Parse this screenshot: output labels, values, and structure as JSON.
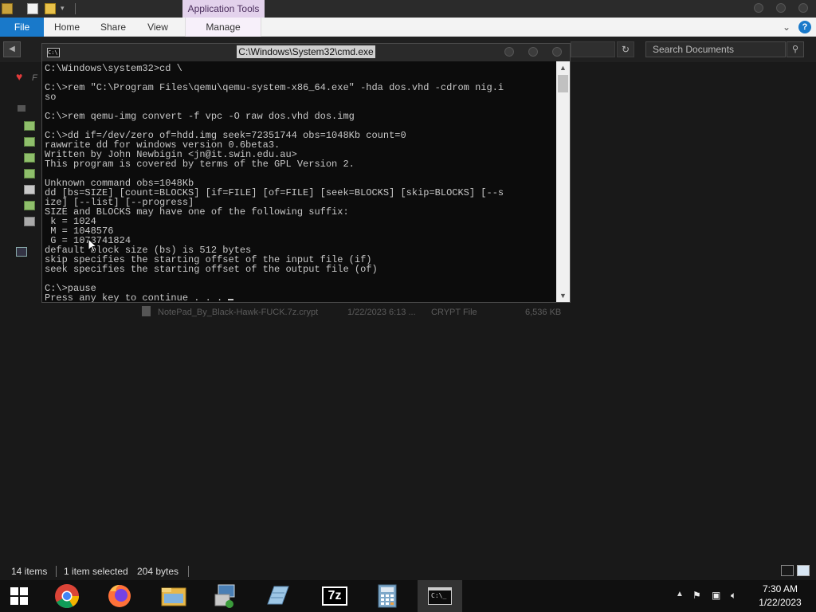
{
  "explorer": {
    "contextual_tab": "Application Tools",
    "tabs": {
      "file": "File",
      "home": "Home",
      "share": "Share",
      "view": "View",
      "manage": "Manage"
    },
    "search_placeholder": "Search Documents",
    "nav_fav_label": "F",
    "file_row": {
      "name": "NotePad_By_Black-Hawk-FUCK.7z.crypt",
      "date": "1/22/2023 6:13 ...",
      "type": "CRYPT File",
      "size": "6,536 KB"
    },
    "status": {
      "item_count": "14 items",
      "selected": "1 item selected",
      "size": "204 bytes"
    }
  },
  "cmd": {
    "title": "C:\\Windows\\System32\\cmd.exe",
    "icon_text": "C:\\",
    "lines": [
      "C:\\Windows\\system32>cd \\",
      "",
      "C:\\>rem \"C:\\Program Files\\qemu\\qemu-system-x86_64.exe\" -hda dos.vhd -cdrom nig.i",
      "so",
      "",
      "C:\\>rem qemu-img convert -f vpc -O raw dos.vhd dos.img",
      "",
      "C:\\>dd if=/dev/zero of=hdd.img seek=72351744 obs=1048Kb count=0",
      "rawwrite dd for windows version 0.6beta3.",
      "Written by John Newbigin <jn@it.swin.edu.au>",
      "This program is covered by terms of the GPL Version 2.",
      "",
      "Unknown command obs=1048Kb",
      "dd [bs=SIZE] [count=BLOCKS] [if=FILE] [of=FILE] [seek=BLOCKS] [skip=BLOCKS] [--s",
      "ize] [--list] [--progress]",
      "SIZE and BLOCKS may have one of the following suffix:",
      " k = 1024",
      " M = 1048576",
      " G = 1073741824",
      "default block size (bs) is 512 bytes",
      "skip specifies the starting offset of the input file (if)",
      "seek specifies the starting offset of the output file (of)",
      "",
      "C:\\>pause",
      "Press any key to continue . . . "
    ]
  },
  "taskbar": {
    "apps": [
      "chrome-icon",
      "firefox-icon",
      "file-explorer-icon",
      "remote-desktop-icon",
      "notepad-icon",
      "7zip-icon",
      "calculator-icon",
      "cmd-icon"
    ],
    "seven_zip_label": "7z",
    "cmd_label": "C:\\_",
    "clock_time": "7:30 AM",
    "clock_date": "1/22/2023"
  },
  "colors": {
    "file_tab": "#1979ca",
    "app_tools": "#e3d2ec",
    "console_bg": "#0c0c0c",
    "console_fg": "#c8c8c8"
  }
}
